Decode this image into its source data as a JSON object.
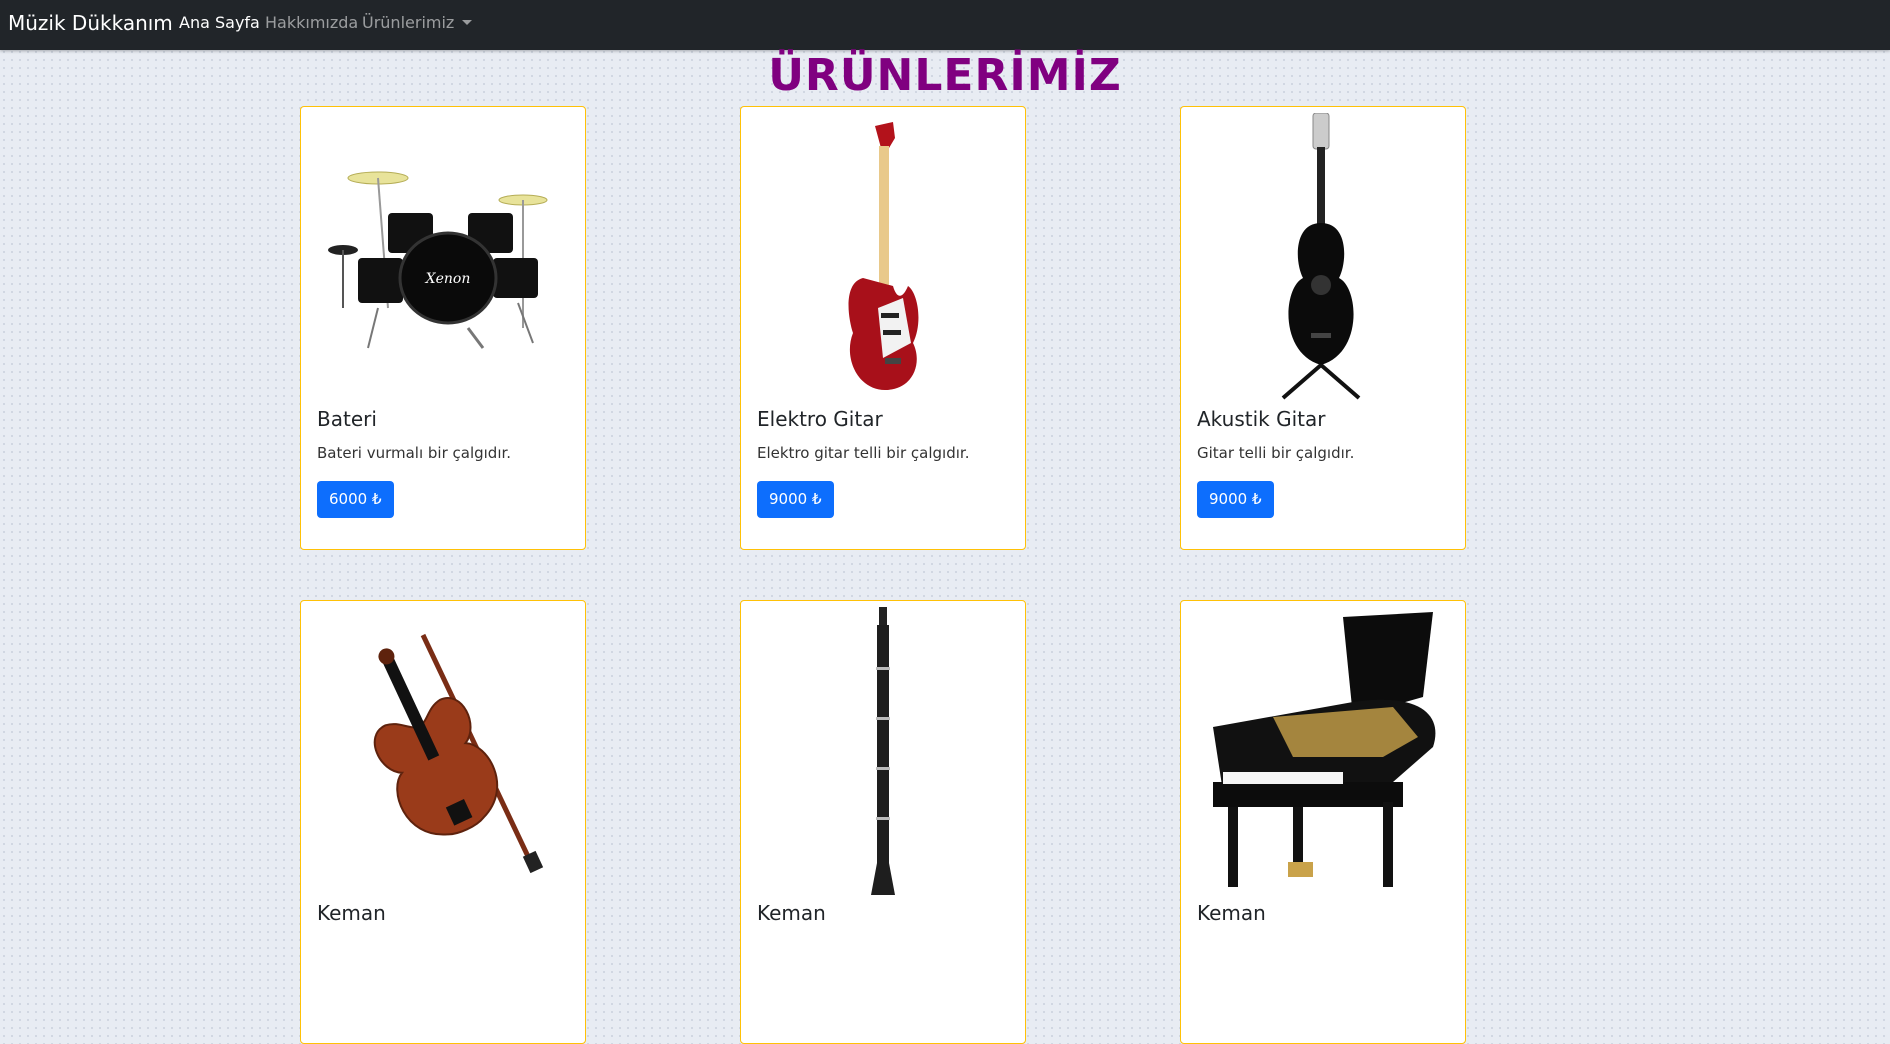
{
  "navbar": {
    "brand": "Müzik Dükkanım",
    "links": [
      {
        "label": "Ana Sayfa"
      },
      {
        "label": "Hakkımızda"
      },
      {
        "label": "Ürünlerimiz"
      }
    ]
  },
  "page_title": "ÜRÜNLERİMİZ",
  "products": [
    {
      "title": "Bateri",
      "description": "Bateri vurmalı bir çalgıdır.",
      "price": "6000 ₺",
      "icon": "drum-kit-icon"
    },
    {
      "title": "Elektro Gitar",
      "description": "Elektro gitar telli bir çalgıdır.",
      "price": "9000 ₺",
      "icon": "electric-guitar-icon"
    },
    {
      "title": "Akustik Gitar",
      "description": "Gitar telli bir çalgıdır.",
      "price": "9000 ₺",
      "icon": "acoustic-guitar-icon"
    },
    {
      "title": "Keman",
      "icon": "violin-icon"
    },
    {
      "title": "Keman",
      "icon": "clarinet-icon"
    },
    {
      "title": "Keman",
      "icon": "grand-piano-icon"
    }
  ],
  "colors": {
    "navbar_bg": "#212529",
    "title": "#800080",
    "card_border": "#ffc107",
    "button": "#0d6efd"
  }
}
